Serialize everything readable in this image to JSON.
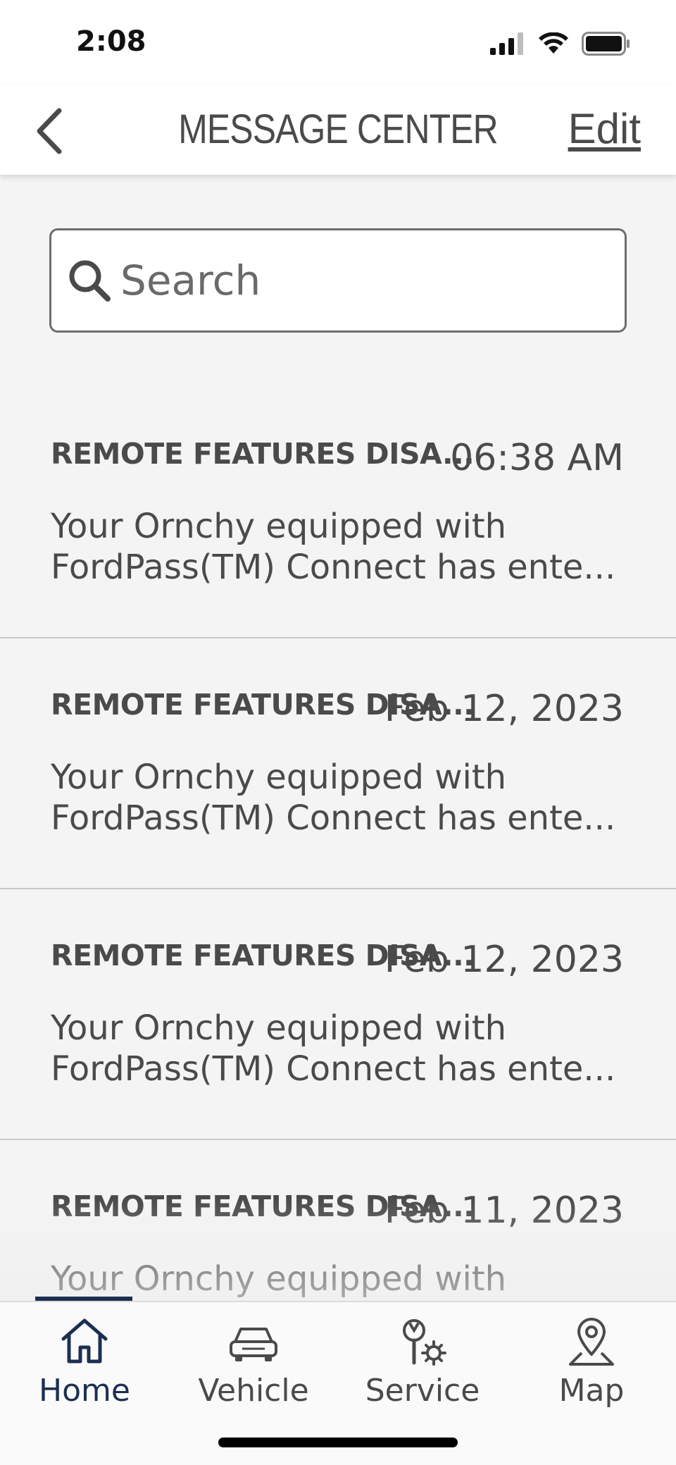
{
  "status_bar": {
    "time": "2:08"
  },
  "header": {
    "title": "MESSAGE CENTER",
    "edit_label": "Edit"
  },
  "search": {
    "placeholder": "Search"
  },
  "messages": [
    {
      "title": "REMOTE FEATURES DISA...",
      "date": "06:38 AM",
      "body_line1": "Your Ornchy equipped with",
      "body_line2": "FordPass(TM) Connect has ente..."
    },
    {
      "title": "REMOTE FEATURES DISA...",
      "date": "Feb 12, 2023",
      "body_line1": "Your Ornchy equipped with",
      "body_line2": "FordPass(TM) Connect has ente..."
    },
    {
      "title": "REMOTE FEATURES DISA...",
      "date": "Feb 12, 2023",
      "body_line1": "Your Ornchy equipped with",
      "body_line2": "FordPass(TM) Connect has ente..."
    },
    {
      "title": "REMOTE FEATURES DISA...",
      "date": "Feb 11, 2023",
      "body_line1": "Your Ornchy equipped with",
      "body_line2": ""
    }
  ],
  "nav": {
    "home": "Home",
    "vehicle": "Vehicle",
    "service": "Service",
    "map": "Map"
  },
  "colors": {
    "accent": "#1c2f52",
    "text": "#4a4a4a",
    "background": "#f4f4f4"
  }
}
